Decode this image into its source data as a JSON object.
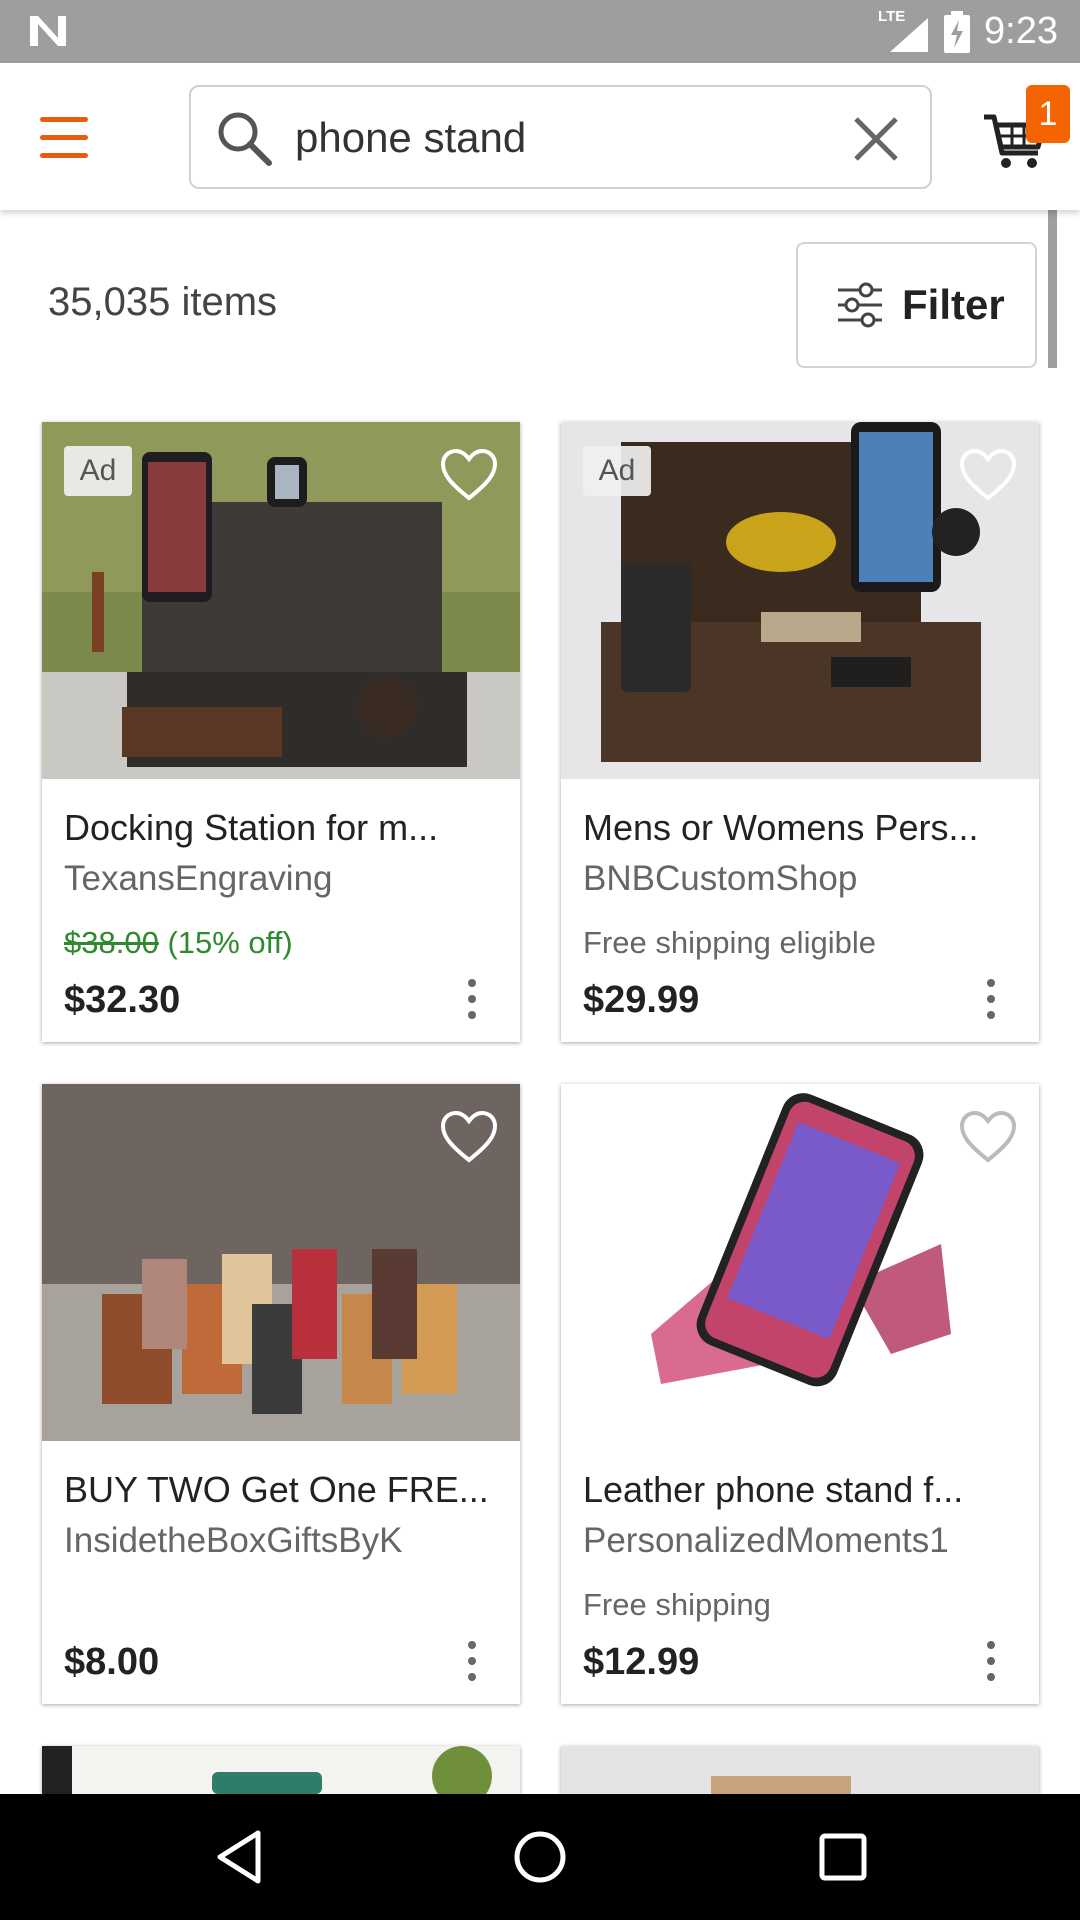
{
  "status_bar": {
    "time": "9:23",
    "network": "LTE"
  },
  "search": {
    "query": "phone stand"
  },
  "cart": {
    "badge_count": "1"
  },
  "results": {
    "count_text": "35,035 items",
    "filter_label": "Filter"
  },
  "products": [
    {
      "ad": "Ad",
      "title": "Docking Station for m...",
      "shop": "TexansEngraving",
      "original_price": "$38.00",
      "discount": "(15% off)",
      "shipping": "",
      "price": "$32.30"
    },
    {
      "ad": "Ad",
      "title": "Mens or Womens Pers...",
      "shop": "BNBCustomShop",
      "original_price": "",
      "discount": "",
      "shipping": "Free shipping eligible",
      "price": "$29.99"
    },
    {
      "ad": "",
      "title": "BUY TWO Get One FRE...",
      "shop": "InsidetheBoxGiftsByK",
      "original_price": "",
      "discount": "",
      "shipping": "",
      "price": "$8.00"
    },
    {
      "ad": "",
      "title": "Leather phone stand f...",
      "shop": "PersonalizedMoments1",
      "original_price": "",
      "discount": "",
      "shipping": "Free shipping",
      "price": "$12.99"
    }
  ],
  "colors": {
    "accent": "#f56400",
    "menu": "#e85d0c",
    "discount_green": "#2f8a2f"
  },
  "icons": [
    "n-logo-icon",
    "signal-icon",
    "battery-icon",
    "menu-icon",
    "search-icon",
    "clear-icon",
    "cart-icon",
    "filter-icon",
    "heart-icon",
    "more-vert-icon",
    "back-icon",
    "home-icon",
    "recents-icon"
  ]
}
